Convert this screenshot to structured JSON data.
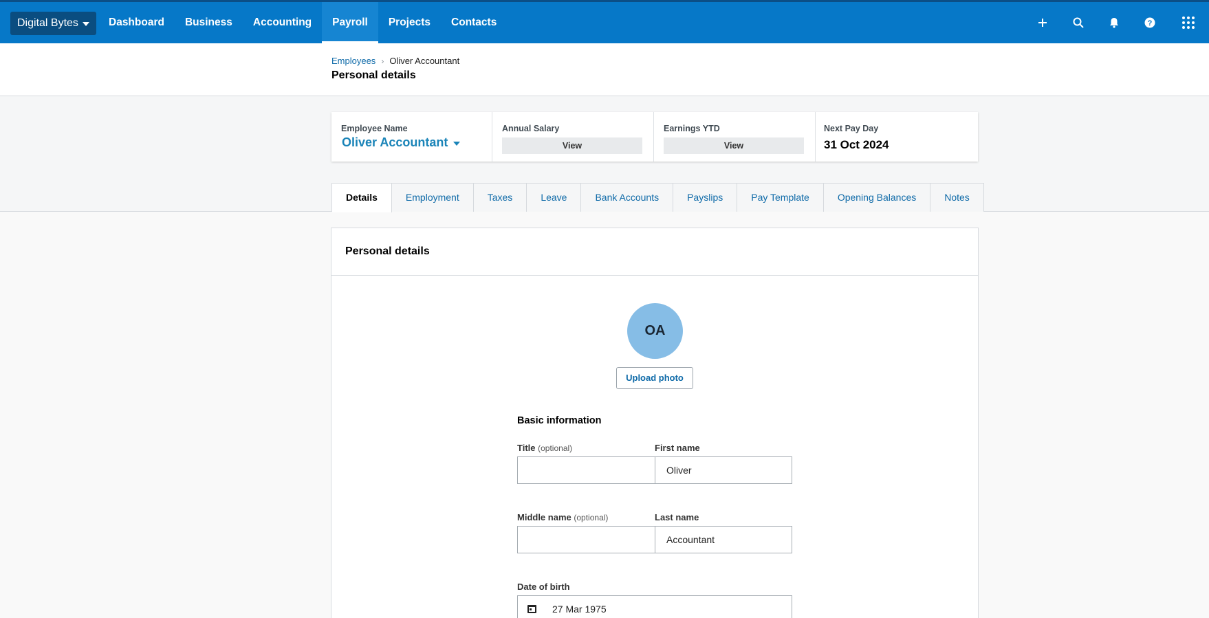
{
  "topbar": {
    "org_name": "Digital Bytes",
    "nav": [
      "Dashboard",
      "Business",
      "Accounting",
      "Payroll",
      "Projects",
      "Contacts"
    ],
    "active_nav": "Payroll",
    "icons": [
      "plus-icon",
      "search-icon",
      "bell-icon",
      "help-icon",
      "apps-grid-icon"
    ],
    "colors": {
      "bar": "#0678c8",
      "org_button": "#0a4d80"
    }
  },
  "header": {
    "breadcrumb_link": "Employees",
    "breadcrumb_current": "Oliver Accountant",
    "page_title": "Personal details"
  },
  "summary": {
    "employee_name_label": "Employee Name",
    "employee_name": "Oliver Accountant",
    "annual_salary_label": "Annual Salary",
    "annual_salary_button": "View",
    "earnings_ytd_label": "Earnings YTD",
    "earnings_ytd_button": "View",
    "next_pay_day_label": "Next Pay Day",
    "next_pay_day": "31 Oct 2024"
  },
  "tabs": [
    "Details",
    "Employment",
    "Taxes",
    "Leave",
    "Bank Accounts",
    "Payslips",
    "Pay Template",
    "Opening Balances",
    "Notes"
  ],
  "active_tab": "Details",
  "panel": {
    "title": "Personal details",
    "avatar_initials": "OA",
    "upload_photo": "Upload photo",
    "section_title": "Basic information",
    "title_label": "Title",
    "title_optional": "(optional)",
    "title_value": "",
    "first_name_label": "First name",
    "first_name_value": "Oliver",
    "middle_name_label": "Middle name",
    "middle_name_optional": "(optional)",
    "middle_name_value": "",
    "last_name_label": "Last name",
    "last_name_value": "Accountant",
    "dob_label": "Date of birth",
    "dob_value": "27 Mar 1975"
  }
}
